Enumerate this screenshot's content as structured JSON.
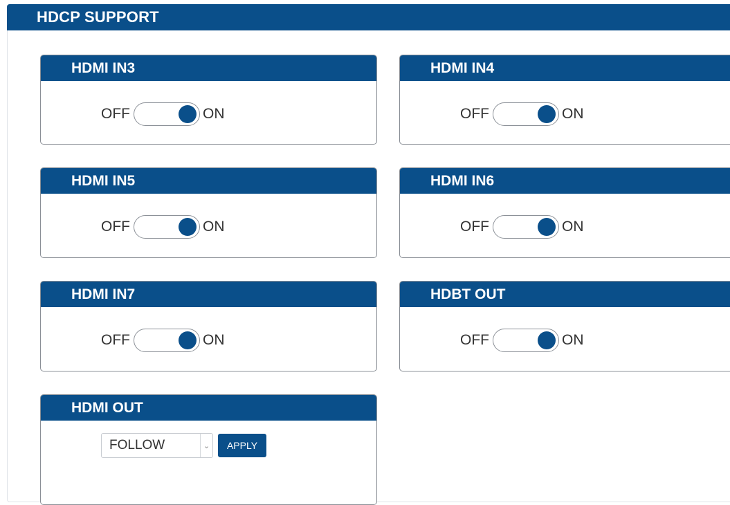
{
  "section_title": "HDCP SUPPORT",
  "toggle_off_label": "OFF",
  "toggle_on_label": "ON",
  "panels": [
    {
      "title": "HDMI IN3",
      "state": "ON"
    },
    {
      "title": "HDMI IN4",
      "state": "ON"
    },
    {
      "title": "HDMI IN5",
      "state": "ON"
    },
    {
      "title": "HDMI IN6",
      "state": "ON"
    },
    {
      "title": "HDMI IN7",
      "state": "ON"
    },
    {
      "title": "HDBT OUT",
      "state": "ON"
    }
  ],
  "hdmi_out": {
    "title": "HDMI OUT",
    "selected_option": "FOLLOW",
    "apply_label": "APPLY"
  },
  "colors": {
    "header_blue": "#0a4f8a",
    "border_gray": "#8a8f96"
  }
}
